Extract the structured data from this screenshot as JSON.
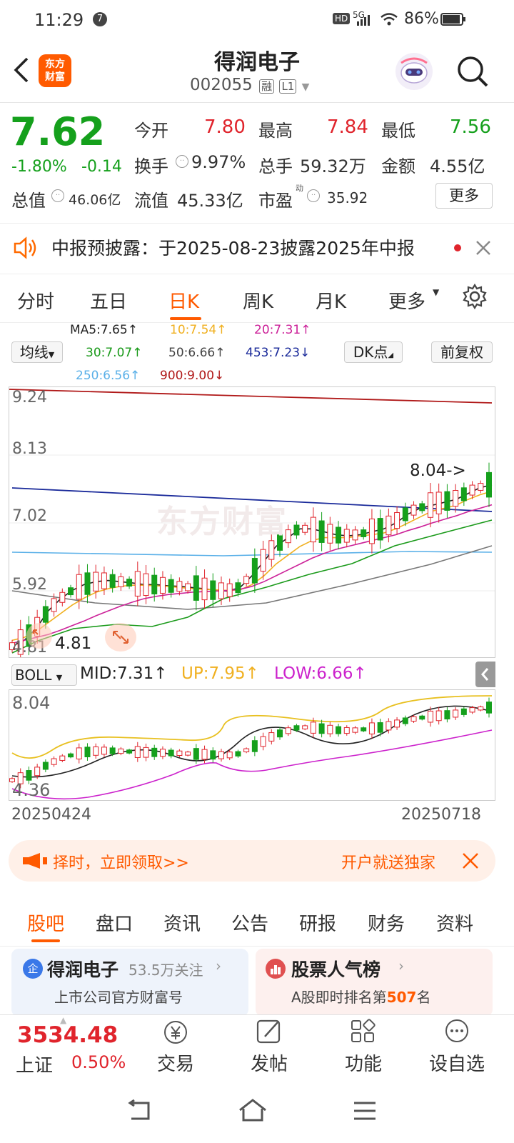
{
  "status_bar": {
    "time": "11:29",
    "notif": "7",
    "network": "5G",
    "battery": "86%"
  },
  "header": {
    "title": "得润电子",
    "code": "002055",
    "tag_rong": "融",
    "tag_level": "L1",
    "logo_line1": "东方",
    "logo_line2": "财富"
  },
  "quote": {
    "price": "7.62",
    "change_pct": "-1.80%",
    "change": "-0.14",
    "open_label": "今开",
    "open": "7.80",
    "high_label": "最高",
    "high": "7.84",
    "low_label": "最低",
    "low": "7.56",
    "turnover_label": "换手",
    "turnover": "9.97%",
    "volume_label": "总手",
    "volume": "59.32万",
    "amount_label": "金额",
    "amount": "4.55亿",
    "mktcap_label": "总值",
    "mktcap": "46.06亿",
    "float_label": "流值",
    "float": "45.33亿",
    "pe_label": "市盈",
    "pe_sup": "动",
    "pe": "35.92",
    "more": "更多"
  },
  "notice": {
    "text": "中报预披露：于2025-08-23披露2025年中报"
  },
  "kline_tabs": [
    "分时",
    "五日",
    "日K",
    "周K",
    "月K",
    "更多"
  ],
  "ma": {
    "selector": "均线",
    "dk": "DK点",
    "adjust": "前复权",
    "ma5": "MA5:7.65↑",
    "ma10": "10:7.54↑",
    "ma20": "20:7.31↑",
    "ma30": "30:7.07↑",
    "ma50": "50:6.66↑",
    "ma453": "453:7.23↓",
    "ma250": "250:6.56↑",
    "ma900": "900:9.00↓"
  },
  "main_chart": {
    "y_labels": [
      "9.24",
      "8.13",
      "7.02",
      "5.92",
      "4.81"
    ],
    "watermark": "东方财富",
    "high_mark": "8.04->",
    "low_mark": "4.81"
  },
  "boll": {
    "selector": "BOLL",
    "mid": "MID:7.31↑",
    "up": "UP:7.95↑",
    "low": "LOW:6.66↑",
    "y_top": "8.04",
    "y_bottom": "4.36"
  },
  "dates": {
    "start": "20250424",
    "end": "20250718"
  },
  "promo": {
    "left": "择时，立即领取>>",
    "right": "开户就送独家"
  },
  "bottom_tabs": [
    "股吧",
    "盘口",
    "资讯",
    "公告",
    "研报",
    "财务",
    "资料"
  ],
  "cards": {
    "left_title": "得润电子",
    "left_count": "53.5万关注",
    "left_sub": "上市公司官方财富号",
    "right_title": "股票人气榜",
    "right_sub_pre": "A股即时排名第",
    "right_rank": "507",
    "right_sub_post": "名"
  },
  "index": {
    "value": "3534.48",
    "name": "上证",
    "pct": "0.50%"
  },
  "nav": {
    "trade": "交易",
    "post": "发帖",
    "func": "功能",
    "watch": "设自选"
  },
  "colors": {
    "up": "#e0242c",
    "down": "#15a01c",
    "accent": "#ff5a00",
    "ma5": "#222222",
    "ma10": "#f0b020",
    "ma20": "#cc2299",
    "ma30": "#1a9a1a",
    "ma453": "#1a2a9a",
    "ma250": "#5ab0e8",
    "ma900": "#b01818"
  },
  "chart_data": {
    "type": "candlestick",
    "x_range": [
      "20250424",
      "20250718"
    ],
    "ylim": [
      4.81,
      9.24
    ],
    "series": [
      {
        "name": "MA5",
        "values": [
          4.9,
          5.0,
          5.2,
          5.5,
          5.7,
          5.85,
          5.95,
          6.0,
          6.02,
          6.0,
          5.98,
          5.95,
          5.95,
          5.93,
          5.92,
          5.9,
          5.88,
          5.85,
          5.84,
          5.9,
          6.1,
          6.35,
          6.6,
          6.75,
          6.9,
          6.9,
          6.85,
          6.8,
          6.78,
          6.8,
          6.85,
          6.9,
          7.0,
          7.15,
          7.25,
          7.3,
          7.35,
          7.4,
          7.5,
          7.6,
          7.65
        ]
      },
      {
        "name": "10",
        "values": [
          5.0,
          5.05,
          5.15,
          5.3,
          5.45,
          5.6,
          5.72,
          5.82,
          5.88,
          5.92,
          5.94,
          5.94,
          5.93,
          5.92,
          5.9,
          5.88,
          5.87,
          5.86,
          5.85,
          5.86,
          5.95,
          6.1,
          6.3,
          6.45,
          6.6,
          6.7,
          6.75,
          6.75,
          6.75,
          6.78,
          6.8,
          6.83,
          6.9,
          7.0,
          7.1,
          7.2,
          7.25,
          7.3,
          7.4,
          7.48,
          7.54
        ]
      },
      {
        "name": "20",
        "values": [
          4.95,
          5.0,
          5.05,
          5.1,
          5.17,
          5.25,
          5.33,
          5.42,
          5.5,
          5.58,
          5.65,
          5.71,
          5.75,
          5.78,
          5.8,
          5.82,
          5.83,
          5.84,
          5.85,
          5.87,
          5.92,
          6.0,
          6.1,
          6.2,
          6.3,
          6.4,
          6.48,
          6.55,
          6.6,
          6.65,
          6.7,
          6.75,
          6.8,
          6.87,
          6.93,
          7.0,
          7.06,
          7.12,
          7.19,
          7.25,
          7.31
        ]
      }
    ]
  }
}
